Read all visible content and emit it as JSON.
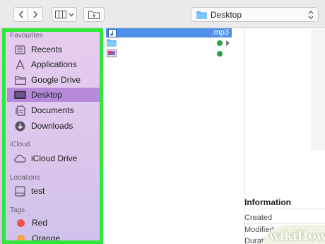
{
  "toolbar": {
    "path_label": "Desktop",
    "icons": {
      "back": "chevron-left-icon",
      "forward": "chevron-right-icon",
      "view": "columns-view-icon",
      "new_folder": "new-folder-icon",
      "path_folder": "folder-icon"
    }
  },
  "sidebar": {
    "favourites_header": "Favourites",
    "favourites": [
      {
        "label": "Recents",
        "icon": "recents-icon"
      },
      {
        "label": "Applications",
        "icon": "applications-icon"
      },
      {
        "label": "Google Drive",
        "icon": "folder-icon"
      },
      {
        "label": "Desktop",
        "icon": "desktop-icon",
        "selected": true
      },
      {
        "label": "Documents",
        "icon": "documents-icon"
      },
      {
        "label": "Downloads",
        "icon": "downloads-icon"
      }
    ],
    "icloud_header": "iCloud",
    "icloud": [
      {
        "label": "iCloud Drive",
        "icon": "cloud-icon"
      }
    ],
    "locations_header": "Locations",
    "locations": [
      {
        "label": "test",
        "icon": "disk-icon"
      }
    ],
    "tags_header": "Tags",
    "tags": [
      {
        "label": "Red",
        "color": "#f0524f"
      },
      {
        "label": "Orange",
        "color": "#f6a343"
      }
    ]
  },
  "files": [
    {
      "name": ".mp3",
      "selected": true,
      "icon": "audio-file-icon"
    },
    {
      "name": "",
      "icon": "folder-icon",
      "synced": true,
      "expandable": true
    },
    {
      "name": "",
      "icon": "image-file-icon",
      "synced": true
    }
  ],
  "info": {
    "title": "Information",
    "created_label": "Created",
    "modified_label": "Modified",
    "duration_label": "Duration"
  },
  "watermark": "wikiHow",
  "colors": {
    "highlight_frame": "#2fe83a",
    "sidebar_selection": "#b68ad9",
    "file_selection": "#4f90e8"
  }
}
